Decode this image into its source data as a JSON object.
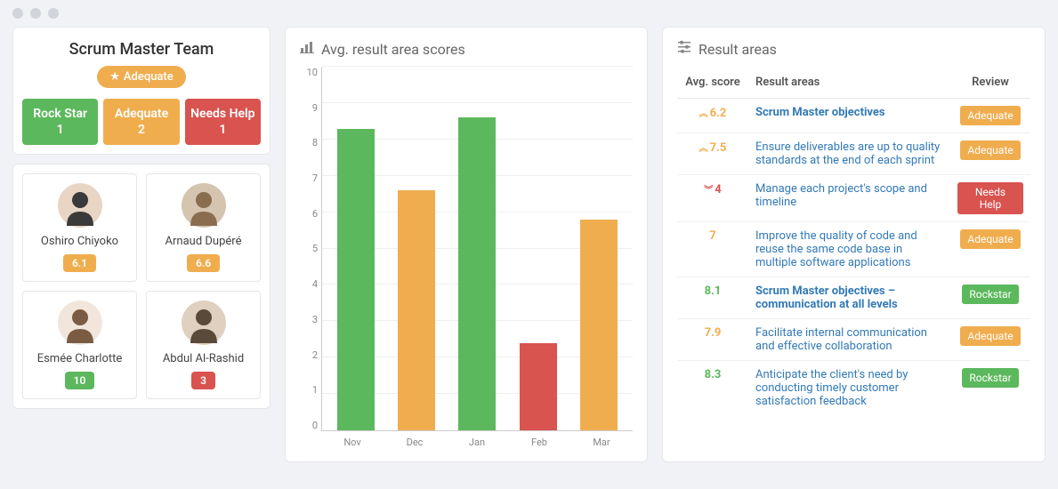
{
  "team": {
    "title": "Scrum Master Team",
    "badge": "Adequate",
    "statuses": [
      {
        "label": "Rock Star",
        "count": "1",
        "color": "green"
      },
      {
        "label": "Adequate",
        "count": "2",
        "color": "orange"
      },
      {
        "label": "Needs Help",
        "count": "1",
        "color": "red"
      }
    ]
  },
  "people": [
    {
      "name": "Oshiro Chiyoko",
      "score": "6.1",
      "color": "orange",
      "avatar_bg": "#e8d5c4",
      "avatar_fg": "#3a3a3a"
    },
    {
      "name": "Arnaud Dupéré",
      "score": "6.6",
      "color": "orange",
      "avatar_bg": "#d4c4b0",
      "avatar_fg": "#8a6d4f"
    },
    {
      "name": "Esmée Charlotte",
      "score": "10",
      "color": "green",
      "avatar_bg": "#f2e6dc",
      "avatar_fg": "#7a5c44"
    },
    {
      "name": "Abdul Al-Rashid",
      "score": "3",
      "color": "red",
      "avatar_bg": "#e0d0c0",
      "avatar_fg": "#5a4a3a"
    }
  ],
  "chart_header": "Avg. result area scores",
  "chart_data": {
    "type": "bar",
    "categories": [
      "Nov",
      "Dec",
      "Jan",
      "Feb",
      "Mar"
    ],
    "values": [
      8.3,
      6.6,
      8.6,
      2.4,
      5.8
    ],
    "colors": [
      "#5cb85c",
      "#f0ad4e",
      "#5cb85c",
      "#d9534f",
      "#f0ad4e"
    ],
    "title": "Avg. result area scores",
    "xlabel": "",
    "ylabel": "",
    "ylim": [
      0,
      10
    ],
    "yticks": [
      0,
      1,
      2,
      3,
      4,
      5,
      6,
      7,
      8,
      9,
      10
    ]
  },
  "results_header": "Result areas",
  "results_columns": {
    "score": "Avg. score",
    "area": "Result areas",
    "review": "Review"
  },
  "results": [
    {
      "score": "6.2",
      "trend": "up",
      "score_color": "orange",
      "area": "Scrum Master objectives",
      "strong": true,
      "review": "Adequate",
      "review_color": "orange"
    },
    {
      "score": "7.5",
      "trend": "up",
      "score_color": "orange",
      "area": "Ensure deliverables are up to quality standards at the end of each sprint",
      "strong": false,
      "review": "Adequate",
      "review_color": "orange"
    },
    {
      "score": "4",
      "trend": "down",
      "score_color": "red",
      "area": "Manage each project's scope and timeline",
      "strong": false,
      "review": "Needs Help",
      "review_color": "red"
    },
    {
      "score": "7",
      "trend": "",
      "score_color": "orange",
      "area": "Improve the quality of code and reuse the same code base in multiple software applications",
      "strong": false,
      "review": "Adequate",
      "review_color": "orange"
    },
    {
      "score": "8.1",
      "trend": "",
      "score_color": "green",
      "area": "Scrum Master objectives – communication at all levels",
      "strong": true,
      "review": "Rockstar",
      "review_color": "green"
    },
    {
      "score": "7.9",
      "trend": "",
      "score_color": "orange",
      "area": "Facilitate internal communication and effective collaboration",
      "strong": false,
      "review": "Adequate",
      "review_color": "orange"
    },
    {
      "score": "8.3",
      "trend": "",
      "score_color": "green",
      "area": "Anticipate the client's need by conducting timely customer satisfaction feedback",
      "strong": false,
      "review": "Rockstar",
      "review_color": "green"
    }
  ],
  "colors": {
    "green": "#5cb85c",
    "orange": "#f0ad4e",
    "red": "#d9534f",
    "link": "#337ab7"
  }
}
